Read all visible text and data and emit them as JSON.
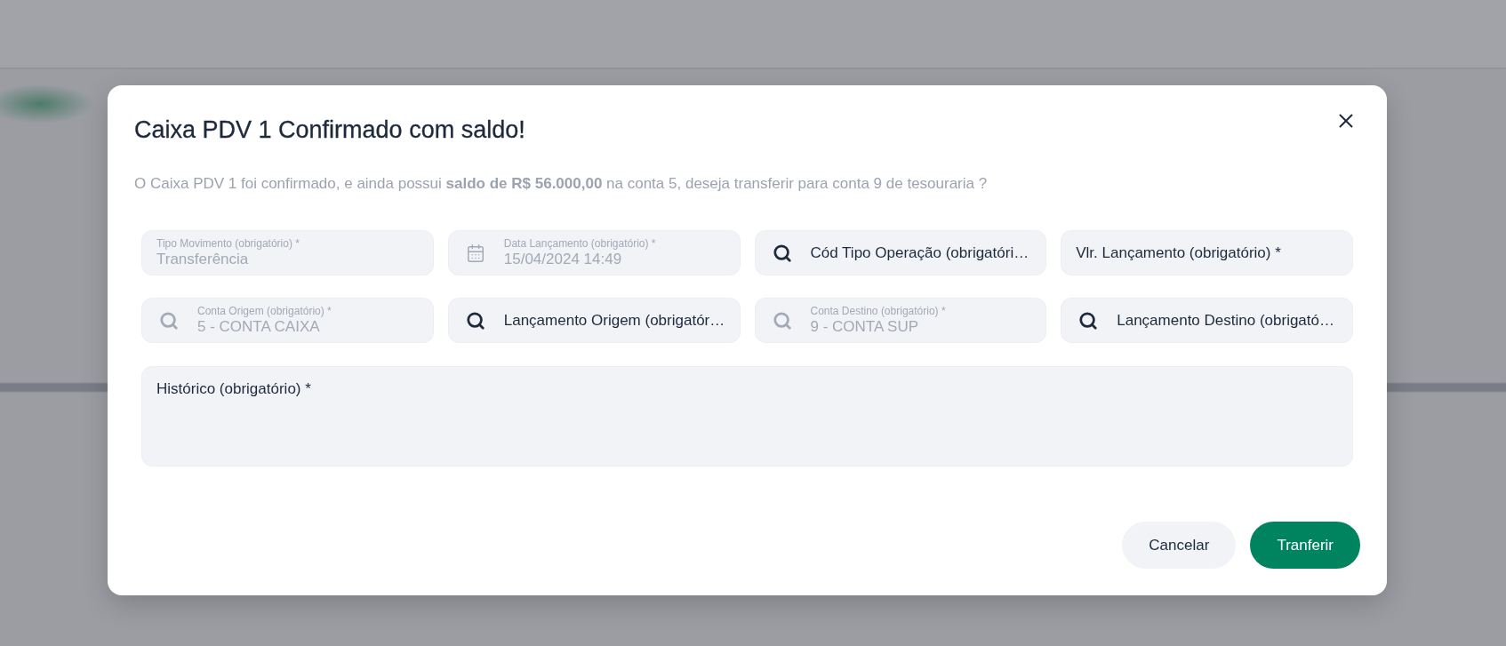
{
  "dialog": {
    "title": "Caixa PDV 1 Confirmado com saldo!",
    "message": "O Caixa PDV 1 foi confirmado, e ainda possui **saldo de R$ 56.000,00** na conta 5, deseja transferir para conta 9 de tesouraria ?"
  },
  "fields": [
    {
      "kind": "text",
      "label": "Tipo Movimento (obrigatório) *",
      "value": "Transferência",
      "disabled": true
    },
    {
      "kind": "date",
      "label": "Data Lançamento (obrigatório) *",
      "value": "15/04/2024 14:49",
      "disabled": true
    },
    {
      "kind": "search",
      "placeholder": "Cód Tipo Operação (obrigatóri…",
      "disabled": false
    },
    {
      "kind": "text",
      "placeholder": "Vlr. Lançamento (obrigatório) *",
      "disabled": false
    },
    {
      "kind": "search",
      "label": "Conta Origem (obrigatório) *",
      "value": "5 - CONTA CAIXA",
      "disabled": true
    },
    {
      "kind": "search",
      "placeholder": "Lançamento Origem (obrigatór…",
      "disabled": false
    },
    {
      "kind": "search",
      "label": "Conta Destino (obrigatório) *",
      "value": "9 - CONTA SUP",
      "disabled": true
    },
    {
      "kind": "search",
      "placeholder": "Lançamento Destino (obrigató…",
      "disabled": false
    }
  ],
  "history": {
    "placeholder": "Histórico (obrigatório) *"
  },
  "buttons": [
    {
      "label": "Cancelar",
      "kind": "secondary"
    },
    {
      "label": "Tranferir",
      "kind": "primary"
    }
  ]
}
